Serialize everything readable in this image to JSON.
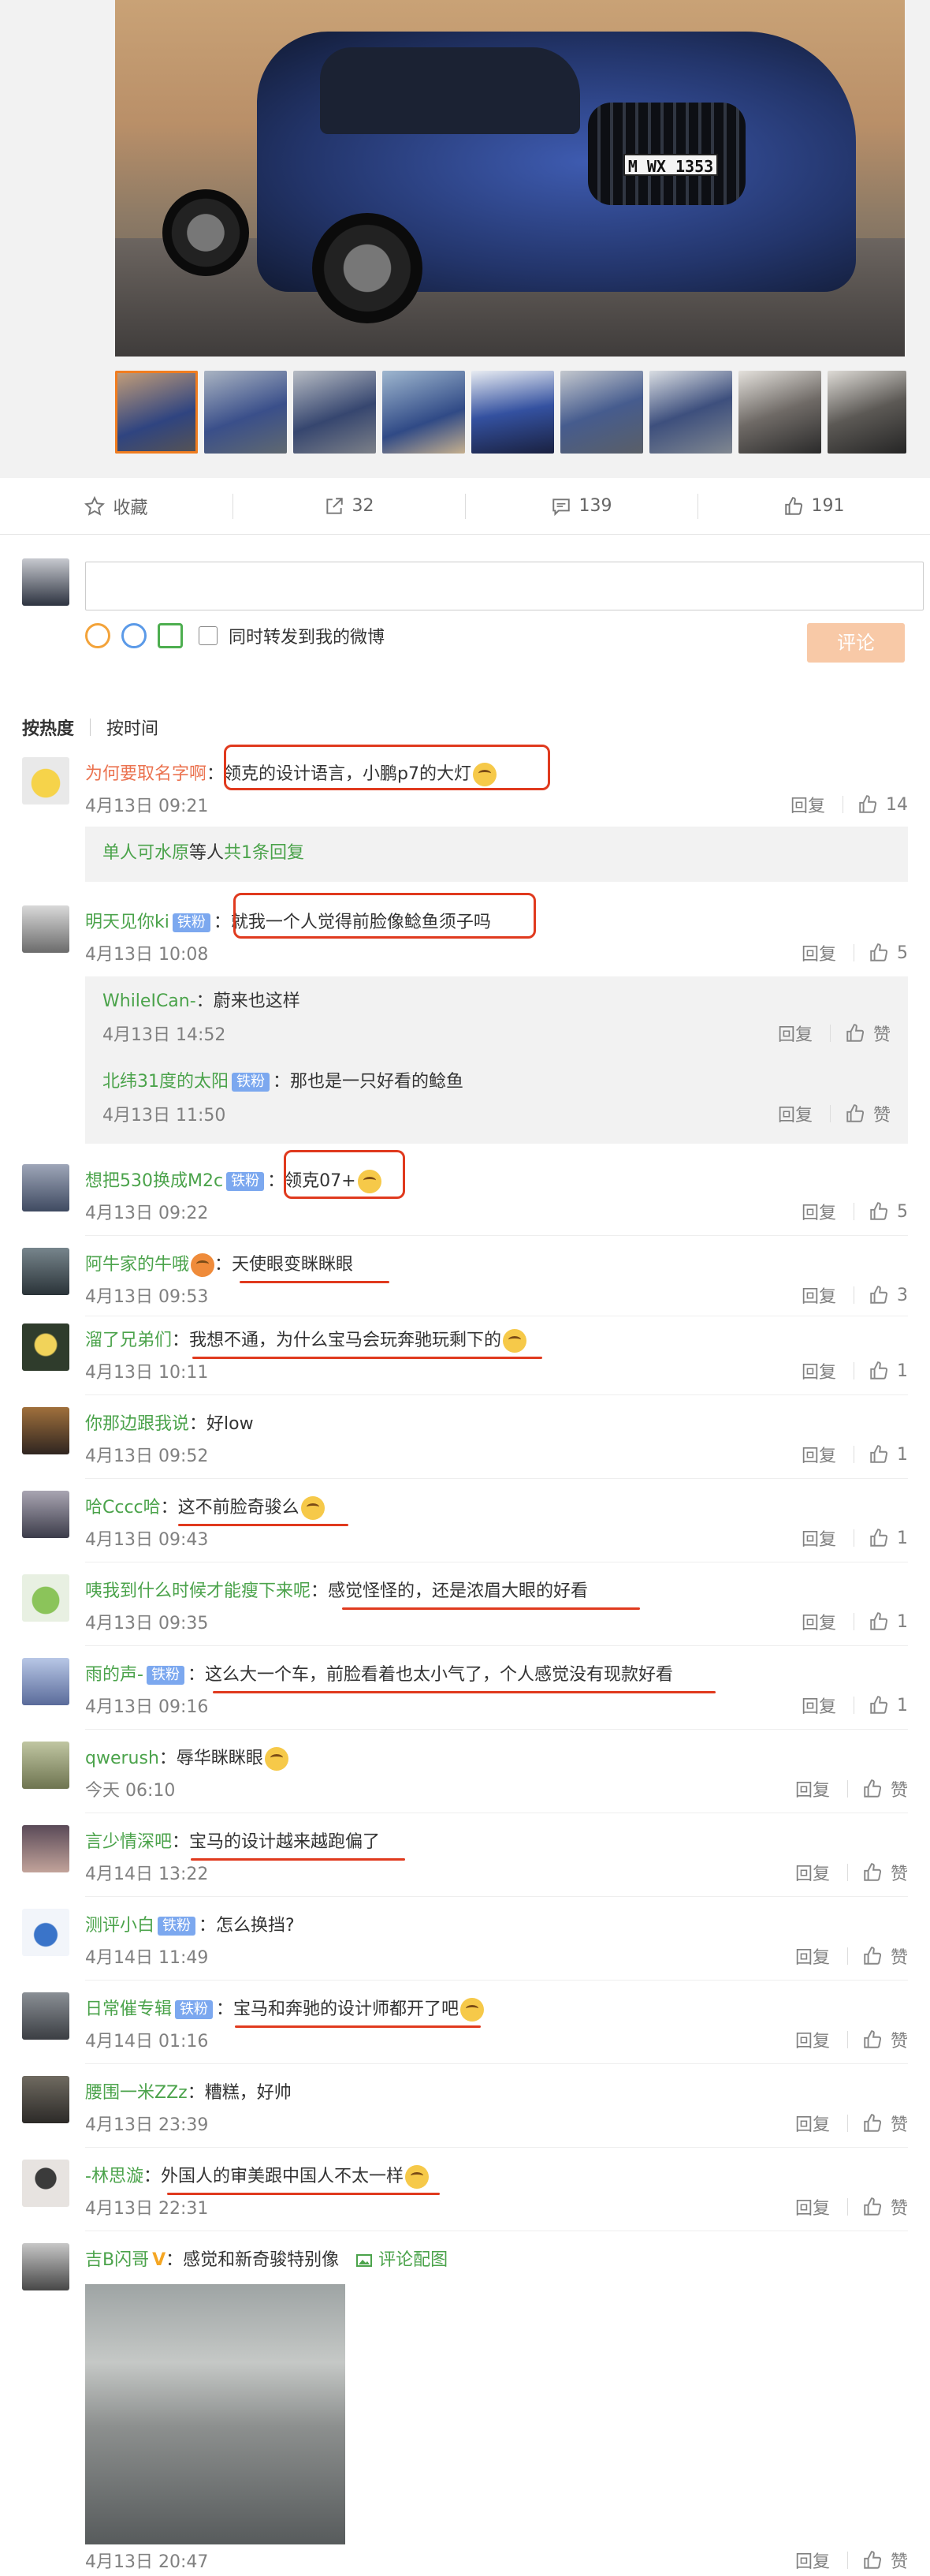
{
  "hero": {
    "plate": "M WX 1353"
  },
  "actions": [
    {
      "icon": "star-icon",
      "label": "收藏"
    },
    {
      "icon": "share-icon",
      "label": "32"
    },
    {
      "icon": "comment-icon",
      "label": "139"
    },
    {
      "icon": "like-icon",
      "label": "191"
    }
  ],
  "composer": {
    "placeholder": "",
    "repost_label": "同时转发到我的微博",
    "submit_label": "评论"
  },
  "sort": {
    "hot": "按热度",
    "time": "按时间"
  },
  "ops": {
    "reply": "回复",
    "like_zero": "赞"
  },
  "comments": [
    {
      "user": "为何要取名字啊",
      "text": "领克的设计语言，小鹏p7的大灯",
      "time": "4月13日 09:21",
      "likes": "14"
    },
    {
      "user": "单人可水原",
      "mid": " 等人",
      "link": " 共1条回复"
    },
    {
      "user": "明天见你ki",
      "badge": "铁粉",
      "text": "就我一个人觉得前脸像鲶鱼须子吗",
      "time": "4月13日 10:08",
      "likes": "5"
    },
    {
      "user": "WhileICan-",
      "text": "蔚来也这样",
      "time": "4月13日 14:52",
      "likes": "赞"
    },
    {
      "user": "北纬31度的太阳",
      "badge": "铁粉",
      "text": "那也是一只好看的鲶鱼",
      "time": "4月13日 11:50",
      "likes": "赞"
    },
    {
      "user": "想把530换成M2c",
      "badge": "铁粉",
      "text": "领克07+",
      "time": "4月13日 09:22",
      "likes": "5"
    },
    {
      "user": "阿牛家的牛哦",
      "text": "天使眼变眯眯眼",
      "time": "4月13日 09:53",
      "likes": "3"
    },
    {
      "user": "溜了兄弟们",
      "text": "我想不通，为什么宝马会玩奔驰玩剩下的",
      "time": "4月13日 10:11",
      "likes": "1"
    },
    {
      "user": "你那边跟我说",
      "text": "好low",
      "time": "4月13日 09:52",
      "likes": "1"
    },
    {
      "user": "哈Cccc哈",
      "text": "这不前脸奇骏么",
      "time": "4月13日 09:43",
      "likes": "1"
    },
    {
      "user": "咦我到什么时候才能瘦下来呢",
      "text": "感觉怪怪的，还是浓眉大眼的好看",
      "time": "4月13日 09:35",
      "likes": "1"
    },
    {
      "user": "雨的声-",
      "badge": "铁粉",
      "text": "这么大一个车，前脸看着也太小气了，个人感觉没有现款好看",
      "time": "4月13日 09:16",
      "likes": "1"
    },
    {
      "user": "qwerush",
      "text": "辱华眯眯眼",
      "time": "今天 06:10",
      "likes": "赞"
    },
    {
      "user": "言少情深吧",
      "text": "宝马的设计越来越跑偏了",
      "time": "4月14日 13:22",
      "likes": "赞"
    },
    {
      "user": "测评小白",
      "badge": "铁粉",
      "text": "怎么换挡?",
      "time": "4月14日 11:49",
      "likes": "赞"
    },
    {
      "user": "日常催专辑",
      "badge": "铁粉",
      "text": "宝马和奔驰的设计师都开了吧",
      "time": "4月14日 01:16",
      "likes": "赞"
    },
    {
      "user": "腰围一米ZZz",
      "text": "糟糕，好帅",
      "time": "4月13日 23:39",
      "likes": "赞"
    },
    {
      "user": "-林思漩",
      "text": "外国人的审美跟中国人不太一样",
      "time": "4月13日 22:31",
      "likes": "赞"
    },
    {
      "user": "吉B闪哥",
      "vip": "V",
      "text": "感觉和新奇骏特别像",
      "img_link": "评论配图",
      "time": "4月13日 20:47",
      "likes": "赞"
    }
  ],
  "colors": {
    "username": "#eb7350",
    "username_alt": "#4ba34b",
    "badge": "#7ca8ef",
    "highlight": "#e03a1e",
    "submit": "#f8c9a7",
    "active_thumb": "#f07d20"
  }
}
